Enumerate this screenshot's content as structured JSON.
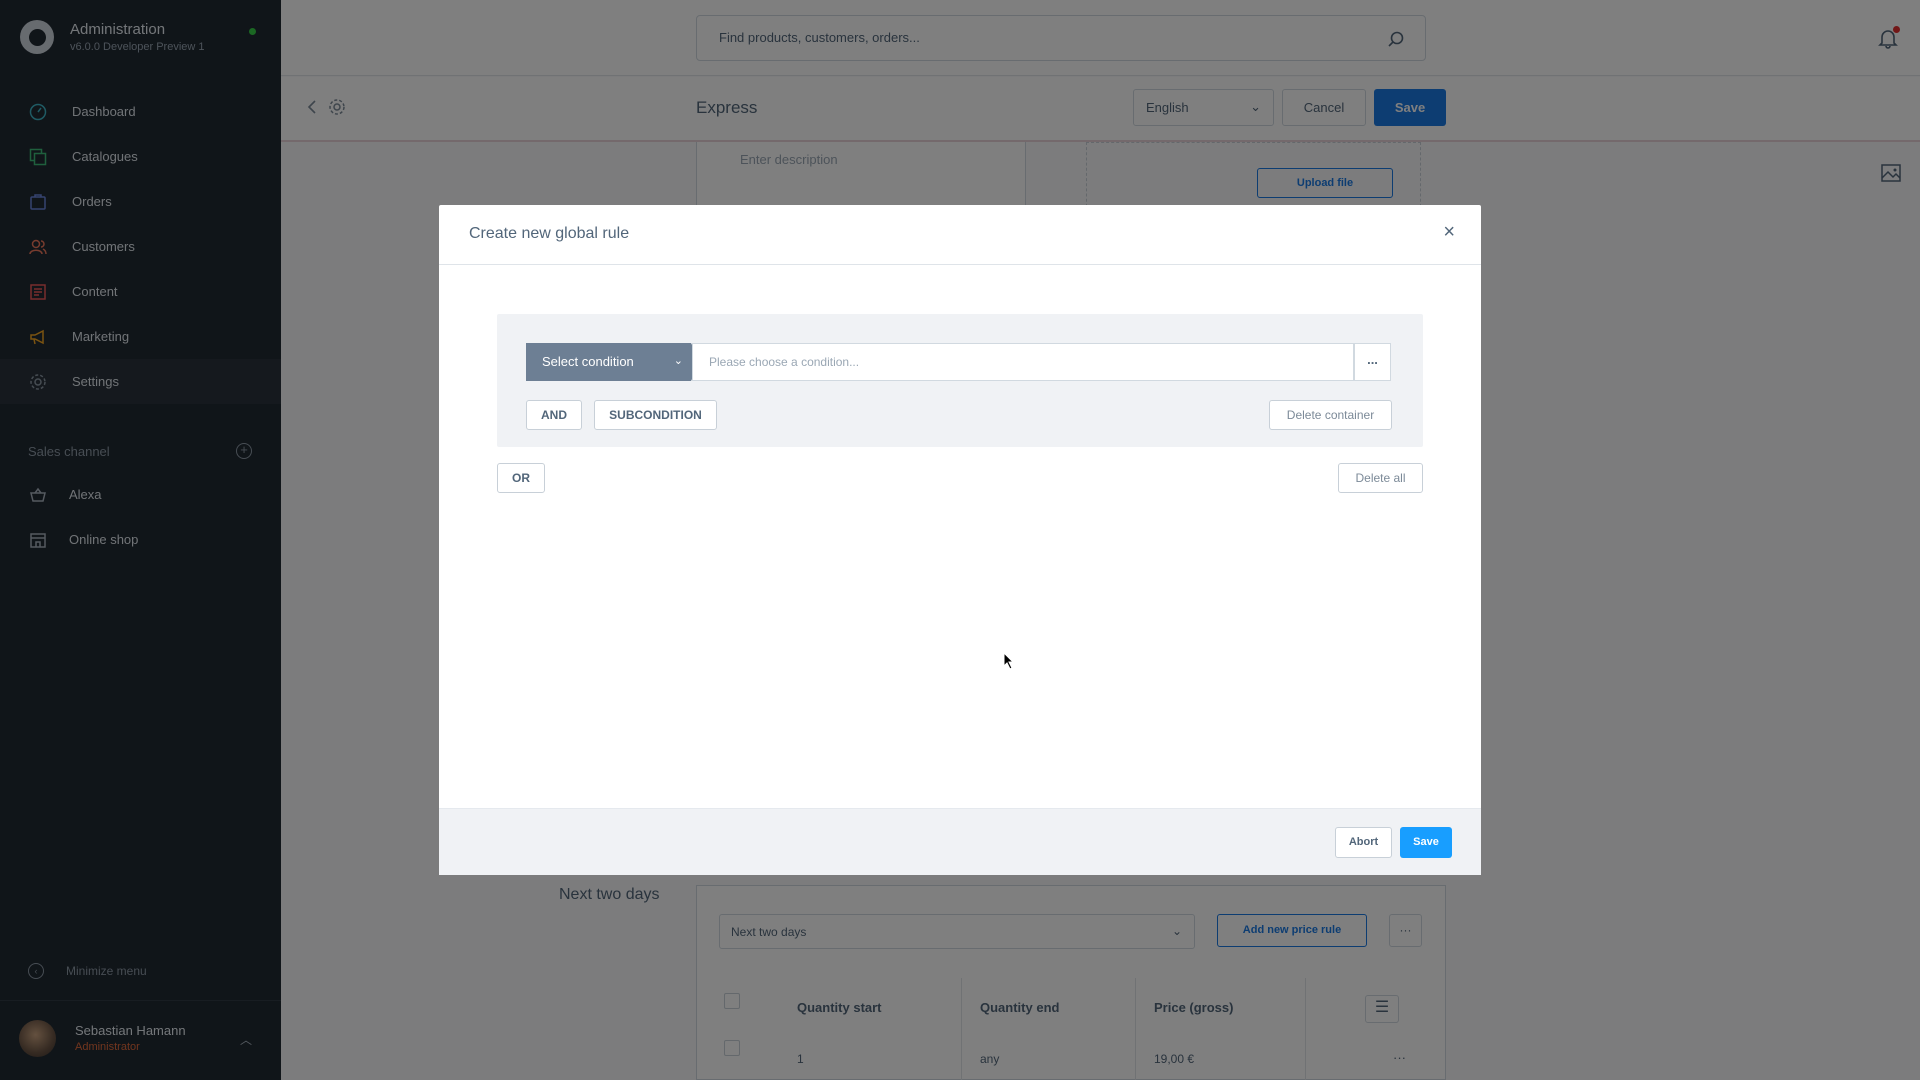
{
  "app": {
    "title": "Administration",
    "version": "v6.0.0 Developer Preview 1"
  },
  "sidebar": {
    "items": [
      {
        "label": "Dashboard",
        "icon": "dashboard-icon"
      },
      {
        "label": "Catalogues",
        "icon": "catalogues-icon"
      },
      {
        "label": "Orders",
        "icon": "orders-icon"
      },
      {
        "label": "Customers",
        "icon": "customers-icon"
      },
      {
        "label": "Content",
        "icon": "content-icon"
      },
      {
        "label": "Marketing",
        "icon": "marketing-icon"
      },
      {
        "label": "Settings",
        "icon": "settings-icon"
      }
    ],
    "sales_channel_title": "Sales channel",
    "channels": [
      {
        "label": "Alexa",
        "icon": "basket-icon"
      },
      {
        "label": "Online shop",
        "icon": "storefront-icon"
      }
    ],
    "minimize_label": "Minimize menu",
    "user": {
      "name": "Sebastian Hamann",
      "role": "Administrator"
    }
  },
  "header": {
    "search_placeholder": "Find products, customers, orders..."
  },
  "smartbar": {
    "title": "Express",
    "language": "English",
    "cancel_label": "Cancel",
    "save_label": "Save"
  },
  "background": {
    "description_placeholder": "Enter description",
    "upload_label": "Upload file",
    "section_label": "Next two days",
    "rule_select_value": "Next two days",
    "add_rule_label": "Add new price rule",
    "table": {
      "headers": [
        "Quantity start",
        "Quantity end",
        "Price (gross)"
      ],
      "row": [
        "1",
        "any",
        "19,00 €"
      ]
    }
  },
  "modal": {
    "title": "Create new global rule",
    "select_condition": "Select condition",
    "condition_placeholder": "Please choose a condition...",
    "context_label": "...",
    "and_label": "AND",
    "subcondition_label": "SUBCONDITION",
    "delete_container_label": "Delete container",
    "or_label": "OR",
    "delete_all_label": "Delete all",
    "abort_label": "Abort",
    "save_label": "Save"
  },
  "colors": {
    "sidebar_bg": "#212a33",
    "primary": "#1a7ae5",
    "modal_save": "#189eff",
    "condition_select": "#6d7f94"
  }
}
